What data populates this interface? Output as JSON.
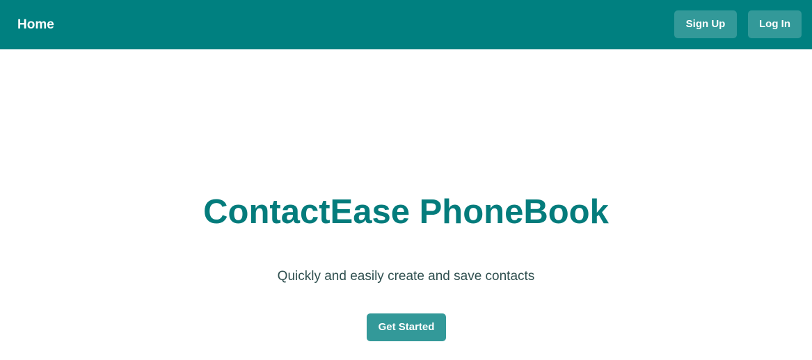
{
  "nav": {
    "home_label": "Home",
    "signup_label": "Sign Up",
    "login_label": "Log In"
  },
  "hero": {
    "title": "ContactEase PhoneBook",
    "subtitle": "Quickly and easily create and save contacts",
    "cta_label": "Get Started"
  },
  "colors": {
    "navbar_bg": "#008080",
    "button_bg": "#339999",
    "title_color": "#047c7c",
    "subtitle_color": "#2f4f4f",
    "page_bg": "#ffffff"
  }
}
